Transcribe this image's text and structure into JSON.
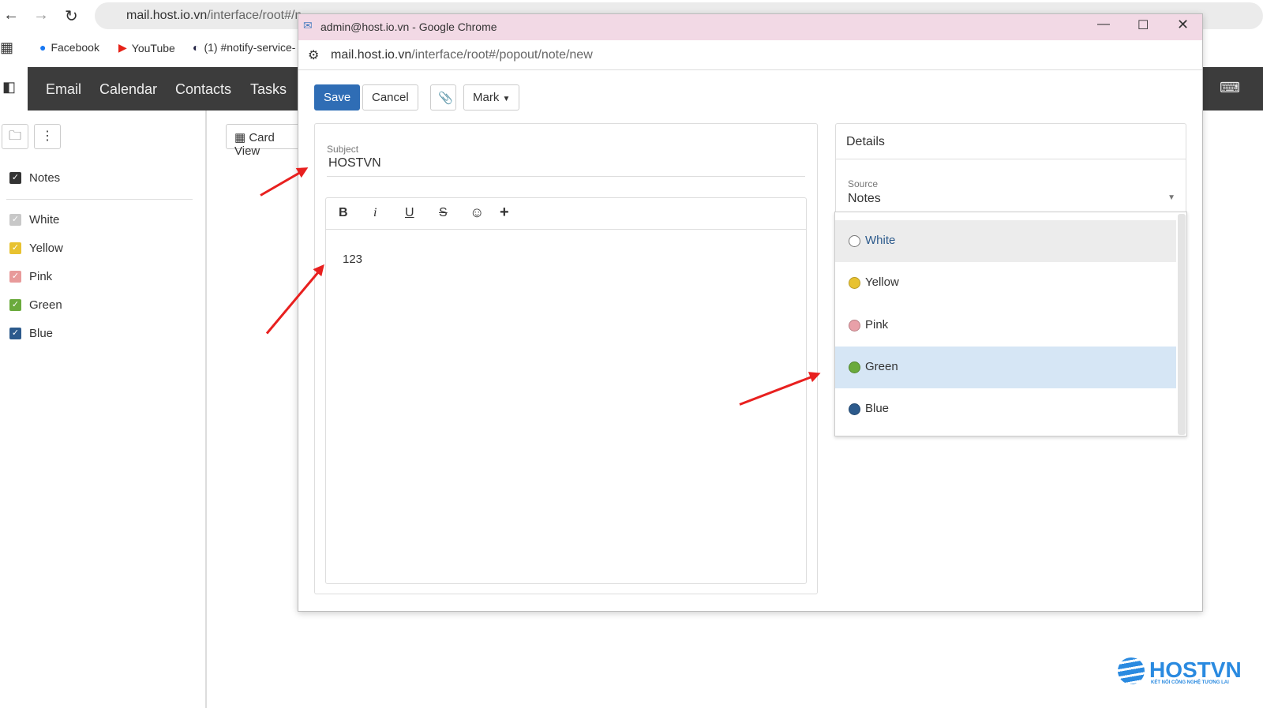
{
  "browser": {
    "url_host": "mail.host.io.vn",
    "url_path": "/interface/root#/n",
    "bookmarks": [
      "Facebook",
      "YouTube",
      "(1) #notify-service-"
    ]
  },
  "app_nav": [
    "Email",
    "Calendar",
    "Contacts",
    "Tasks"
  ],
  "toolbar": {
    "card_view": "Card View"
  },
  "sidebar": {
    "root": "Notes",
    "categories": [
      {
        "label": "White",
        "color": "#c8c8c8"
      },
      {
        "label": "Yellow",
        "color": "#e8c230"
      },
      {
        "label": "Pink",
        "color": "#e89a9a"
      },
      {
        "label": "Green",
        "color": "#6aaa3c"
      },
      {
        "label": "Blue",
        "color": "#2c5a8c"
      }
    ]
  },
  "popup": {
    "title": "admin@host.io.vn - Google Chrome",
    "url_host": "mail.host.io.vn",
    "url_path": "/interface/root#/popout/note/new",
    "save": "Save",
    "cancel": "Cancel",
    "mark": "Mark",
    "subject_label": "Subject",
    "subject_value": "HOSTVN",
    "body": "123",
    "details_title": "Details",
    "source_label": "Source",
    "source_value": "Notes",
    "options": [
      {
        "label": "White",
        "color": "#ffffff"
      },
      {
        "label": "Yellow",
        "color": "#e8c230"
      },
      {
        "label": "Pink",
        "color": "#e8a0a8"
      },
      {
        "label": "Green",
        "color": "#6aaa3c"
      },
      {
        "label": "Blue",
        "color": "#2c5a8c"
      }
    ]
  },
  "logo": {
    "name": "HOSTVN",
    "tagline": "KẾT NỐI CÔNG NGHỆ TƯƠNG LAI"
  }
}
